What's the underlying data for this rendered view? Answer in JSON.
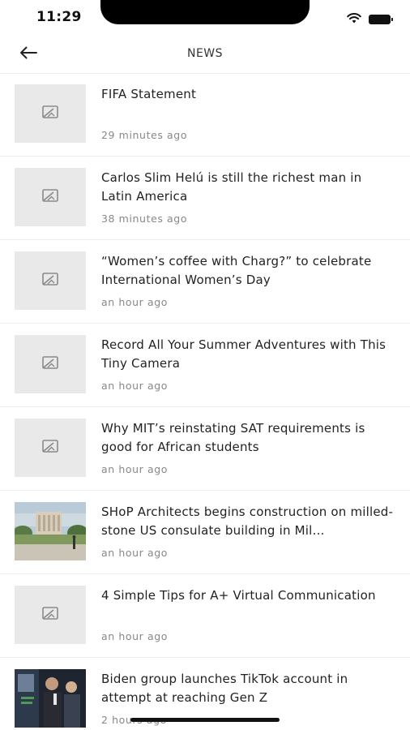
{
  "status_bar": {
    "time": "11:29"
  },
  "header": {
    "title": "NEWS"
  },
  "news": [
    {
      "title": "FIFA Statement",
      "time": "29 minutes ago",
      "thumbnail": "placeholder"
    },
    {
      "title": "Carlos Slim Helú is still the richest man in Latin America",
      "time": "38 minutes ago",
      "thumbnail": "placeholder"
    },
    {
      "title": "“Women’s coffee with Charg?” to celebrate International Women’s Day",
      "time": "an hour ago",
      "thumbnail": "placeholder"
    },
    {
      "title": "Record All Your Summer Adventures with This Tiny Camera",
      "time": "an hour ago",
      "thumbnail": "placeholder"
    },
    {
      "title": "Why MIT’s reinstating SAT requirements is good for African students",
      "time": "an hour ago",
      "thumbnail": "placeholder"
    },
    {
      "title": "SHoP Architects begins construction on milled-stone US consulate building in Mil…",
      "time": "an hour ago",
      "thumbnail": "architecture-photo"
    },
    {
      "title": "4 Simple Tips for A+ Virtual Communication",
      "time": "an hour ago",
      "thumbnail": "placeholder"
    },
    {
      "title": "Biden group launches TikTok account in attempt at reaching Gen Z",
      "time": "2 hours ago",
      "thumbnail": "people-photo"
    }
  ],
  "colors": {
    "placeholder_bg": "#e9e9e9",
    "meta_text": "#888888",
    "divider": "#ededed"
  },
  "icons": {
    "back": "arrow-left-icon",
    "placeholder": "image-broken-icon",
    "wifi": "wifi-icon",
    "battery": "battery-icon"
  }
}
